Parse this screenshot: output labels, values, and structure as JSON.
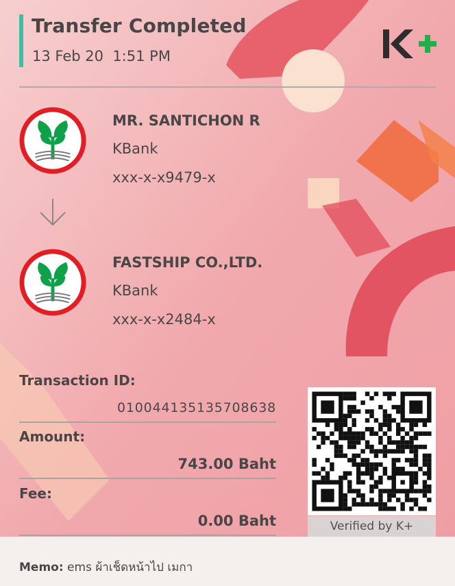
{
  "header": {
    "title": "Transfer Completed",
    "datetime": "13 Feb 20  1:51 PM",
    "brand_logo_icon": "kplus-logo-icon",
    "brand_colors": {
      "k": "#2d2d2d",
      "plus": "#22b04a"
    }
  },
  "sender": {
    "name": "MR. SANTICHON R",
    "bank": "KBank",
    "account": "xxx-x-x9479-x",
    "logo_icon": "kbank-logo-icon"
  },
  "transfer_arrow_icon": "arrow-down-icon",
  "recipient": {
    "name": "FASTSHIP CO.,LTD.",
    "bank": "KBank",
    "account": "xxx-x-x2484-x",
    "logo_icon": "kbank-logo-icon"
  },
  "details": {
    "transaction_id_label": "Transaction ID:",
    "transaction_id": "010044135135708638",
    "amount_label": "Amount:",
    "amount": "743.00 Baht",
    "fee_label": "Fee:",
    "fee": "0.00 Baht"
  },
  "qr": {
    "icon": "qr-code-icon",
    "caption": "Verified by K+"
  },
  "memo": {
    "label": "Memo:",
    "text": "ems ผ้าเช็ดหน้าไป เมกา"
  },
  "colors": {
    "accent": "#3cbfa3",
    "kbank_red": "#e21d23",
    "kbank_green": "#0fa14a",
    "background": "#f2b7b8"
  }
}
